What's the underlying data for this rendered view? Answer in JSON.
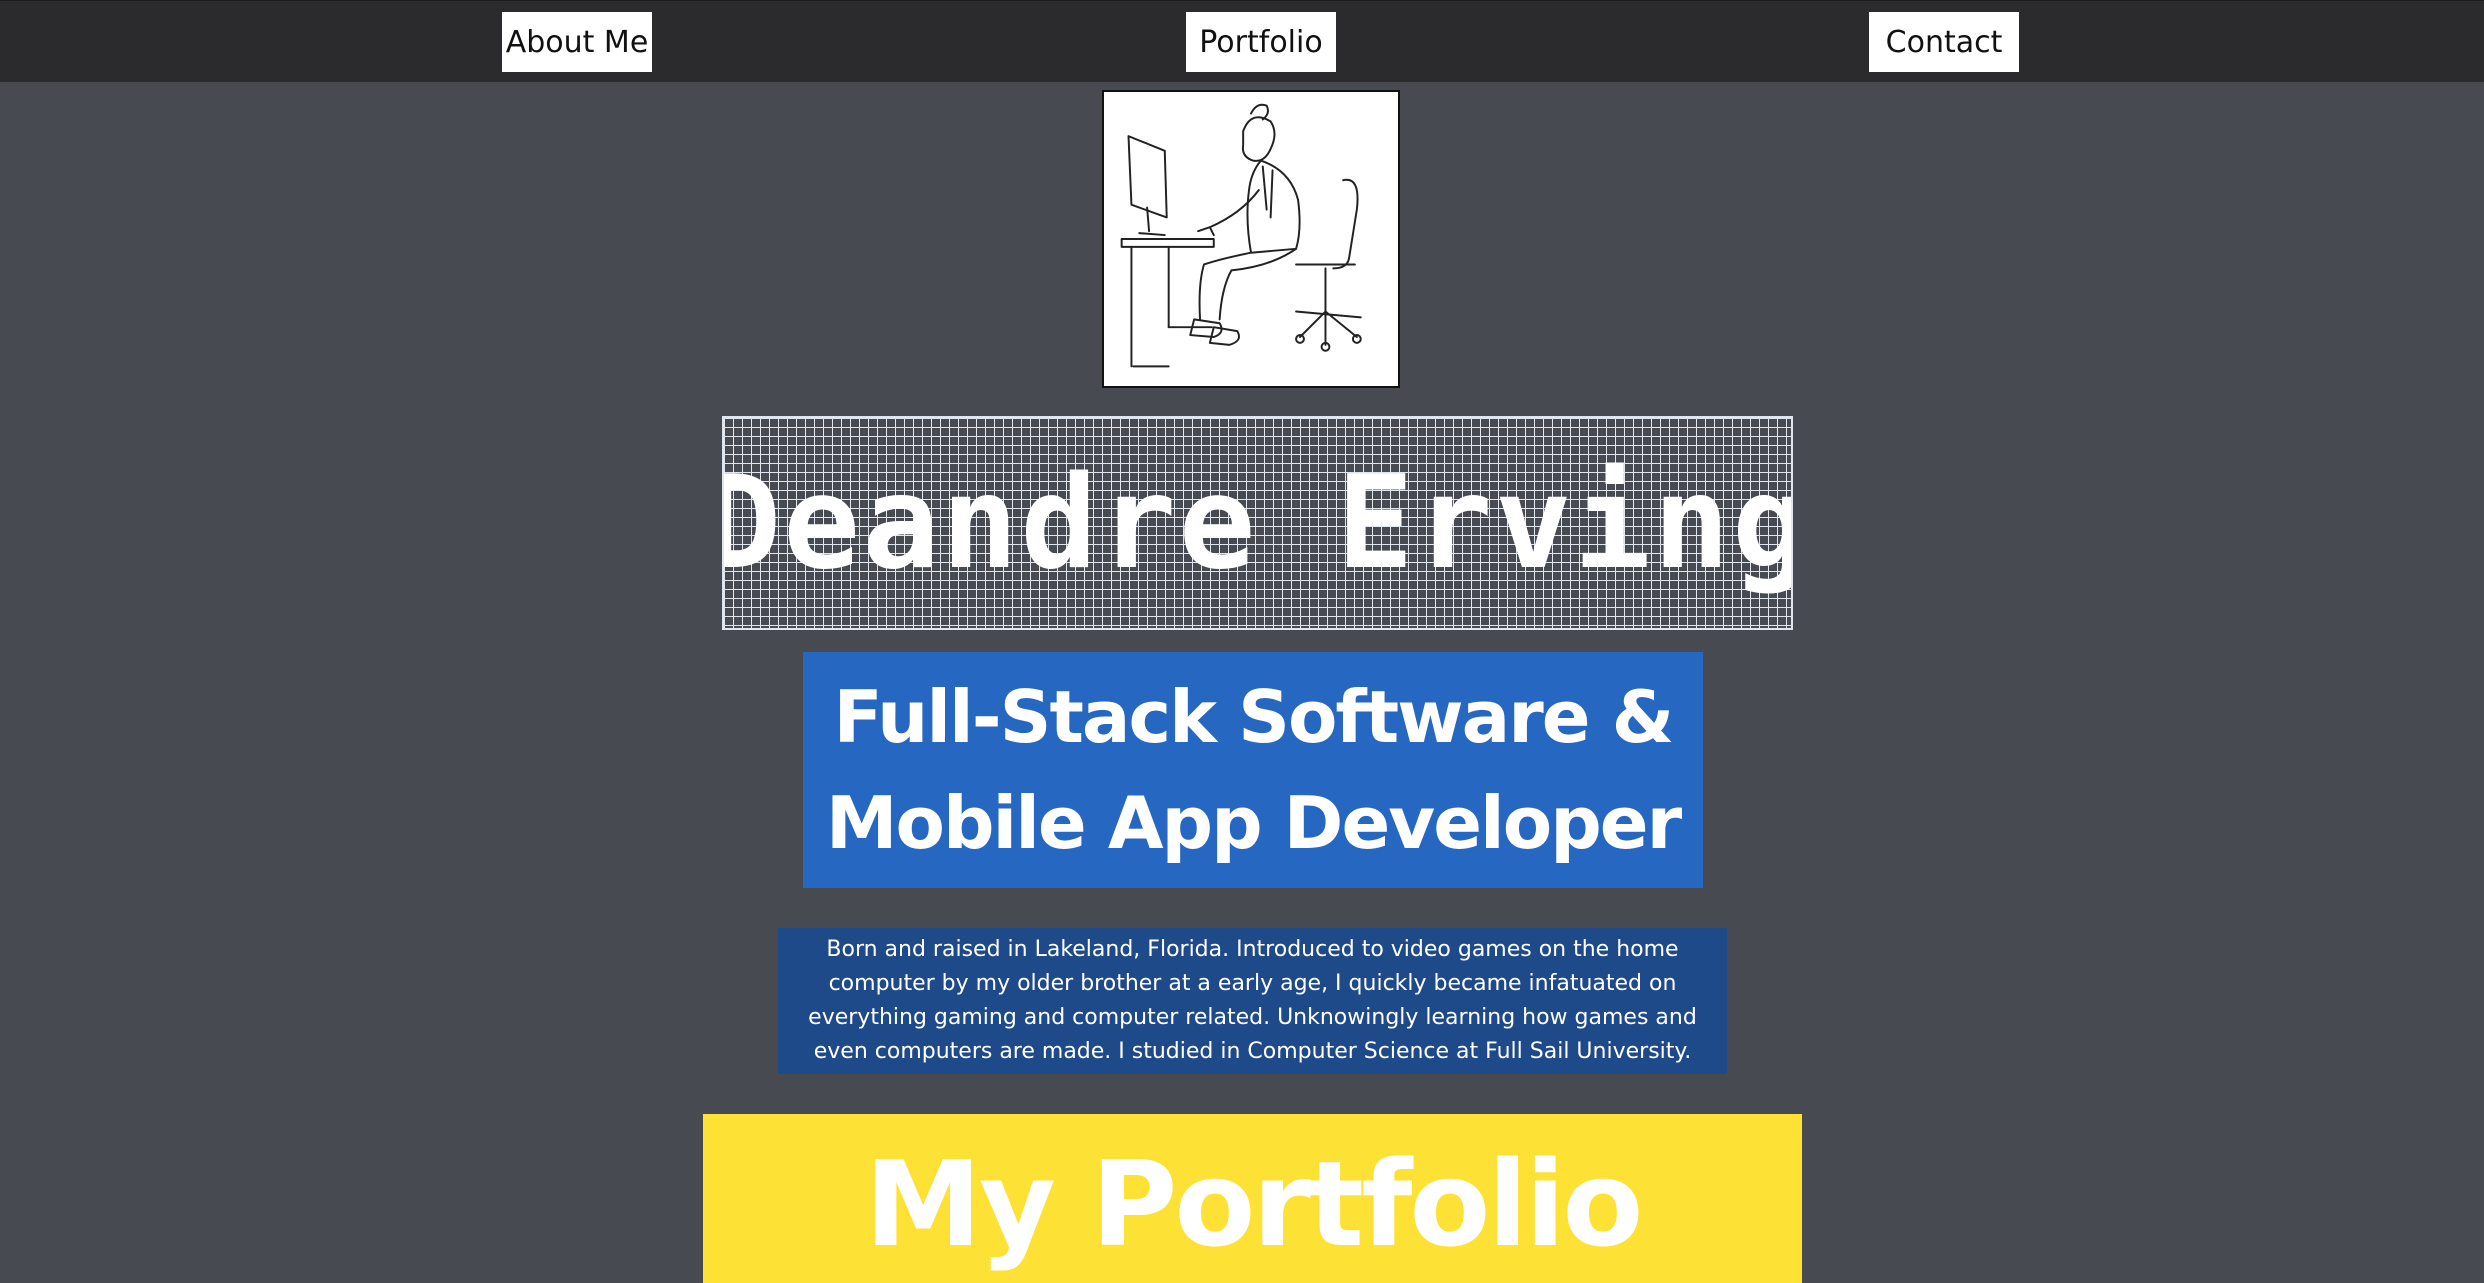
{
  "nav": {
    "items": [
      {
        "label": "About Me"
      },
      {
        "label": "Portfolio"
      },
      {
        "label": "Contact"
      }
    ]
  },
  "hero": {
    "avatar_icon": "developer-at-desk-illustration",
    "name": "Deandre Erving",
    "role": "Full-Stack Software &\nMobile App Developer",
    "bio": "Born and raised in Lakeland, Florida. Introduced to video games on the home computer by my older brother at a early age, I quickly became infatuated on everything gaming and computer related. Unknowingly learning how games and even computers are made. I studied in Computer Science at Full Sail University."
  },
  "portfolio": {
    "heading": "My Portfolio"
  },
  "colors": {
    "nav_bg": "#2b2b2d",
    "page_bg": "#474a50",
    "role_bg": "#2667c1",
    "bio_bg": "#1f4a8a",
    "portfolio_bg": "#fde135"
  }
}
